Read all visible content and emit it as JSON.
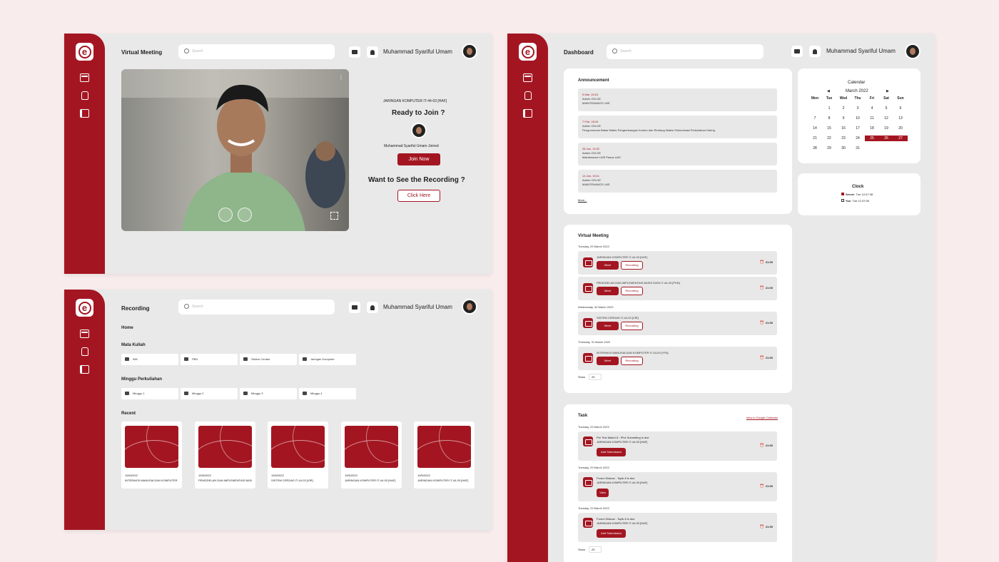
{
  "virtual_meeting_screen": {
    "title": "Virtual Meeting",
    "search_placeholder": "Search",
    "user_name": "Muhammad Syariful Umam",
    "class_name": "JARINGAN KOMPUTER IT-44-03 [HAF]",
    "ready_text": "Ready to Join ?",
    "joined_text": "Muhammad Syariful Umam Joined",
    "join_button": "Join Now",
    "recording_question": "Want to See the Recording ?",
    "click_here_button": "Click Here"
  },
  "recording_screen": {
    "title": "Recording",
    "search_placeholder": "Search",
    "user_name": "Muhammad Syariful Umam",
    "breadcrumb": "Home",
    "mata_kuliah_label": "Mata Kuliah",
    "mata_kuliah": [
      "IMK",
      "PBD",
      "Sistem Cerdas",
      "Jaringan Komputer"
    ],
    "minggu_label": "Minggu Perkuliahan",
    "minggu": [
      "Minggu 1",
      "Minggu 2",
      "Minggu 3",
      "Minggu 4"
    ],
    "recent_label": "Recent",
    "recent": [
      {
        "date": "19/5/2022",
        "name": "INTERAKSI MANUSIA DAN KOMPUTER"
      },
      {
        "date": "19/5/2022",
        "name": "PEMODELAN DAN IMPLEMENTASI BASIS DATA"
      },
      {
        "date": "19/5/2022",
        "name": "SISTEM CERDAS IT-44-03 [VIR]"
      },
      {
        "date": "19/5/2022",
        "name": "JARINGAN KOMPUTER IT-44-03 [HAF]"
      },
      {
        "date": "19/5/2022",
        "name": "JARINGAN KOMPUTER IT-44-03 [HAF]"
      }
    ]
  },
  "dashboard": {
    "title": "Dashboard",
    "search_placeholder": "Search",
    "user_name": "Muhammad Syariful Umam",
    "announcement": {
      "title": "Announcement",
      "items": [
        {
          "date": "5 Mar, 15:24",
          "author": "Admin CELOE",
          "text": "MAINTENANCE LMS"
        },
        {
          "date": "7 Feb, 18:34",
          "author": "Admin CELOE",
          "text": "Pengumuman Batas Waktu Pengembangan Konten dan Rentang Waktu Sinkronisasi Perkuliahan Daring"
        },
        {
          "date": "28 Jan, 11:52",
          "author": "Admin CELOE",
          "text": "Maintenance LMS Pasca UAS"
        },
        {
          "date": "14 Jan, 15:11",
          "author": "Admin CELOE",
          "text": "MAINTENANCE LMS"
        }
      ],
      "more": "More..."
    },
    "calendar": {
      "title": "Calendar",
      "month": "March 2022",
      "prev": "◀",
      "next": "▶",
      "weekdays": [
        "Mon",
        "Tue",
        "Wed",
        "Thu",
        "Fri",
        "Sat",
        "Sun"
      ],
      "days": [
        "",
        "1",
        "2",
        "3",
        "4",
        "5",
        "6",
        "7",
        "8",
        "9",
        "10",
        "11",
        "12",
        "13",
        "14",
        "15",
        "16",
        "17",
        "18",
        "19",
        "20",
        "21",
        "22",
        "23",
        "24",
        "25",
        "26",
        "27",
        "28",
        "29",
        "30",
        "31"
      ],
      "highlighted": [
        "25",
        "26",
        "27"
      ]
    },
    "clock": {
      "title": "Clock",
      "server_label": "Server",
      "server_time": "Tue 12:47:38",
      "you_label": "You",
      "you_time": "Tue 12:47:08"
    },
    "virtual_meeting": {
      "title": "Virtual Meeting",
      "groups": [
        {
          "date": "Tuesday, 29 March 2022",
          "items": [
            {
              "name": "JARINGAN KOMPUTER IT-44-03 [HAF]",
              "time": "21:00"
            },
            {
              "name": "PEMODELAN DAN IMPLEMENTASI BASIS DATA IT-44-03 [PHD]",
              "time": "21:00"
            }
          ]
        },
        {
          "date": "Wednesday, 30 March 2022",
          "items": [
            {
              "name": "SISTEM CERDAS IT-44-03 [VIR]",
              "time": "21:00"
            }
          ]
        },
        {
          "date": "Thursday, 31 March 2022",
          "items": [
            {
              "name": "INTERAKSI MANUSIA DAN KOMPUTER IT-44-03 [YFA]",
              "time": "21:00"
            }
          ]
        }
      ],
      "meet_label": "Meet",
      "recording_label": "Recording",
      "show_label": "Show",
      "show_value": "25"
    },
    "task": {
      "title": "Task",
      "calendar_link": "View in Google Calendar",
      "items": [
        {
          "date": "Tuesday, 29 March 2022",
          "line1": "Pre Test Materi 8 : IPv4 Subnetting is due",
          "line2": "JARINGAN KOMPUTER IT-44-03 [HAF]",
          "button": "Add Submission",
          "time": "21:00"
        },
        {
          "date": "Tuesday, 29 March 2022",
          "line1": "Forum Diskusi - Topik 8 is due",
          "line2": "JARINGAN KOMPUTER IT-44-03 [HAF]",
          "button": "View",
          "time": "21:00"
        },
        {
          "date": "Tuesday, 29 March 2022",
          "line1": "Forum Diskusi - Topik 8 is due",
          "line2": "JARINGAN KOMPUTER IT-44-03 [HAF]",
          "button": "Add Submission",
          "time": "21:00"
        }
      ],
      "show_label": "Show",
      "show_value": "25"
    }
  }
}
